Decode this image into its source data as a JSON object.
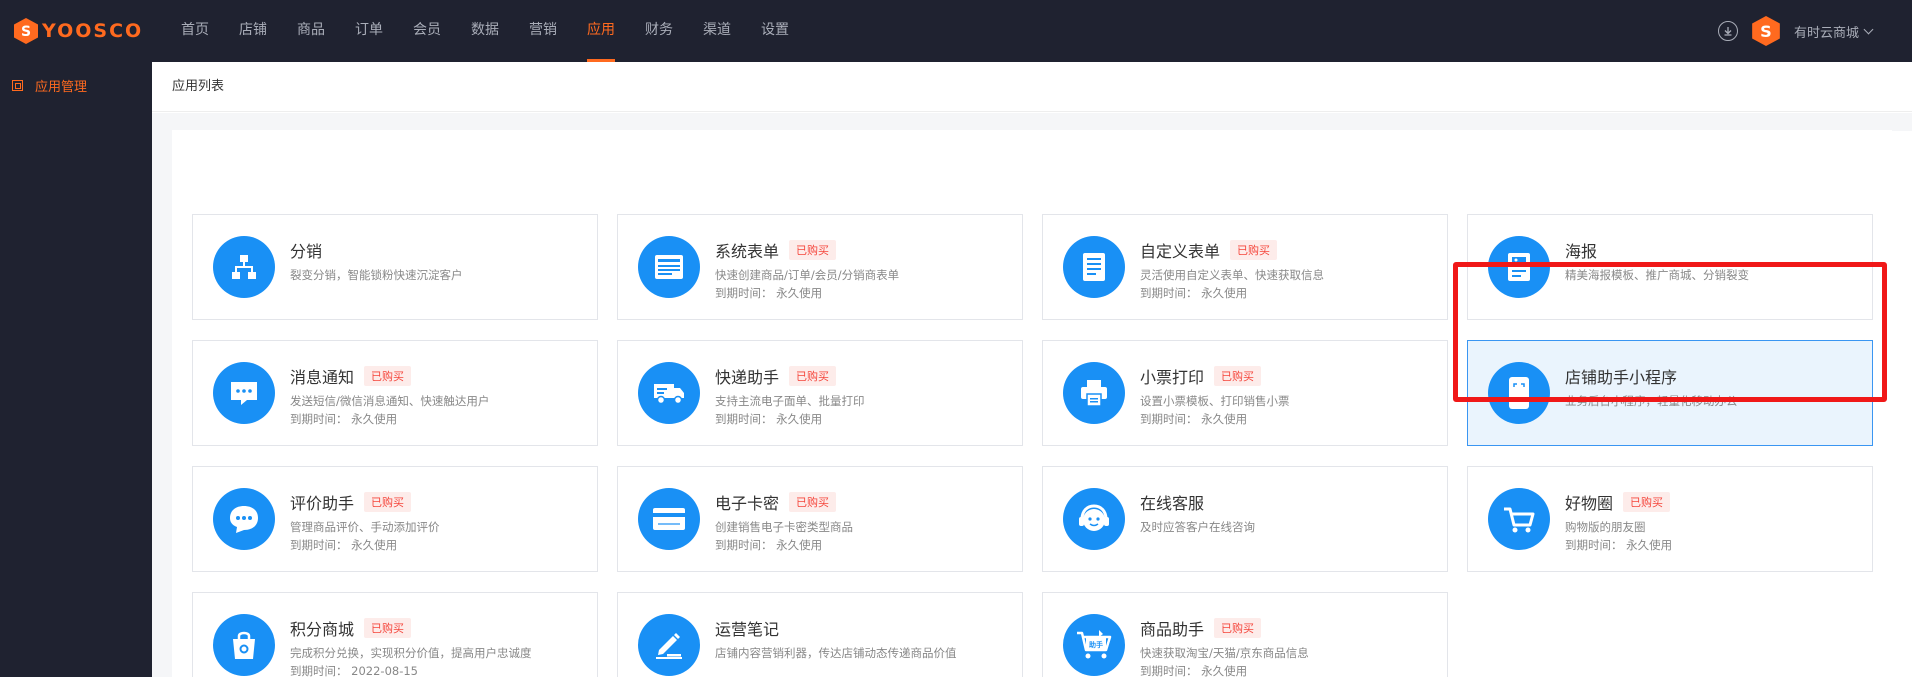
{
  "brand": {
    "logo_text": "YOOSCO",
    "logo_letter": "S",
    "color": "#ff6a1f"
  },
  "nav": [
    {
      "label": "首页"
    },
    {
      "label": "店铺"
    },
    {
      "label": "商品"
    },
    {
      "label": "订单"
    },
    {
      "label": "会员"
    },
    {
      "label": "数据"
    },
    {
      "label": "营销"
    },
    {
      "label": "应用",
      "active": true
    },
    {
      "label": "财务"
    },
    {
      "label": "渠道"
    },
    {
      "label": "设置"
    }
  ],
  "header_right": {
    "shop_name": "有时云商城",
    "avatar_letter": "S"
  },
  "sidebar": {
    "items": [
      {
        "label": "应用管理"
      }
    ]
  },
  "page": {
    "title": "应用列表"
  },
  "apps": [
    {
      "title": "分销",
      "badge": "",
      "desc": "裂变分销，智能锁粉快速沉淀客户",
      "expiry": "",
      "icon": "org-chart-icon"
    },
    {
      "title": "系统表单",
      "badge": "已购买",
      "desc": "快速创建商品/订单/会员/分销商表单",
      "expiry": "到期时间： 永久使用",
      "icon": "form-icon"
    },
    {
      "title": "自定义表单",
      "badge": "已购买",
      "desc": "灵活使用自定义表单、快速获取信息",
      "expiry": "到期时间： 永久使用",
      "icon": "document-icon"
    },
    {
      "title": "海报",
      "badge": "",
      "desc": "精美海报模板、推广商城、分销裂变",
      "expiry": "",
      "icon": "poster-icon"
    },
    {
      "title": "消息通知",
      "badge": "已购买",
      "desc": "发送短信/微信消息通知、快速触达用户",
      "expiry": "到期时间： 永久使用",
      "icon": "message-icon"
    },
    {
      "title": "快递助手",
      "badge": "已购买",
      "desc": "支持主流电子面单、批量打印",
      "expiry": "到期时间： 永久使用",
      "icon": "truck-icon"
    },
    {
      "title": "小票打印",
      "badge": "已购买",
      "desc": "设置小票模板、打印销售小票",
      "expiry": "到期时间： 永久使用",
      "icon": "printer-icon"
    },
    {
      "title": "店铺助手小程序",
      "badge": "",
      "desc": "业务后台小程序，轻量化移动办公",
      "expiry": "",
      "icon": "phone-scan-icon",
      "selected": true
    },
    {
      "title": "评价助手",
      "badge": "已购买",
      "desc": "管理商品评价、手动添加评价",
      "expiry": "到期时间： 永久使用",
      "icon": "chat-bubble-icon"
    },
    {
      "title": "电子卡密",
      "badge": "已购买",
      "desc": "创建销售电子卡密类型商品",
      "expiry": "到期时间： 永久使用",
      "icon": "card-icon"
    },
    {
      "title": "在线客服",
      "badge": "",
      "desc": "及时应答客户在线咨询",
      "expiry": "",
      "icon": "headset-icon"
    },
    {
      "title": "好物圈",
      "badge": "已购买",
      "desc": "购物版的朋友圈",
      "expiry": "到期时间： 永久使用",
      "icon": "cart-icon"
    },
    {
      "title": "积分商城",
      "badge": "已购买",
      "desc": "完成积分兑换，实现积分价值，提高用户忠诚度",
      "expiry": "到期时间： 2022-08-15",
      "icon": "shopping-bag-icon"
    },
    {
      "title": "运营笔记",
      "badge": "",
      "desc": "店铺内容营销利器，传达店铺动态传递商品价值",
      "expiry": "",
      "icon": "pen-icon"
    },
    {
      "title": "商品助手",
      "badge": "已购买",
      "desc": "快速获取淘宝/天猫/京东商品信息",
      "expiry": "到期时间： 永久使用",
      "icon": "helper-cart-icon",
      "icon_text": "助手"
    }
  ]
}
